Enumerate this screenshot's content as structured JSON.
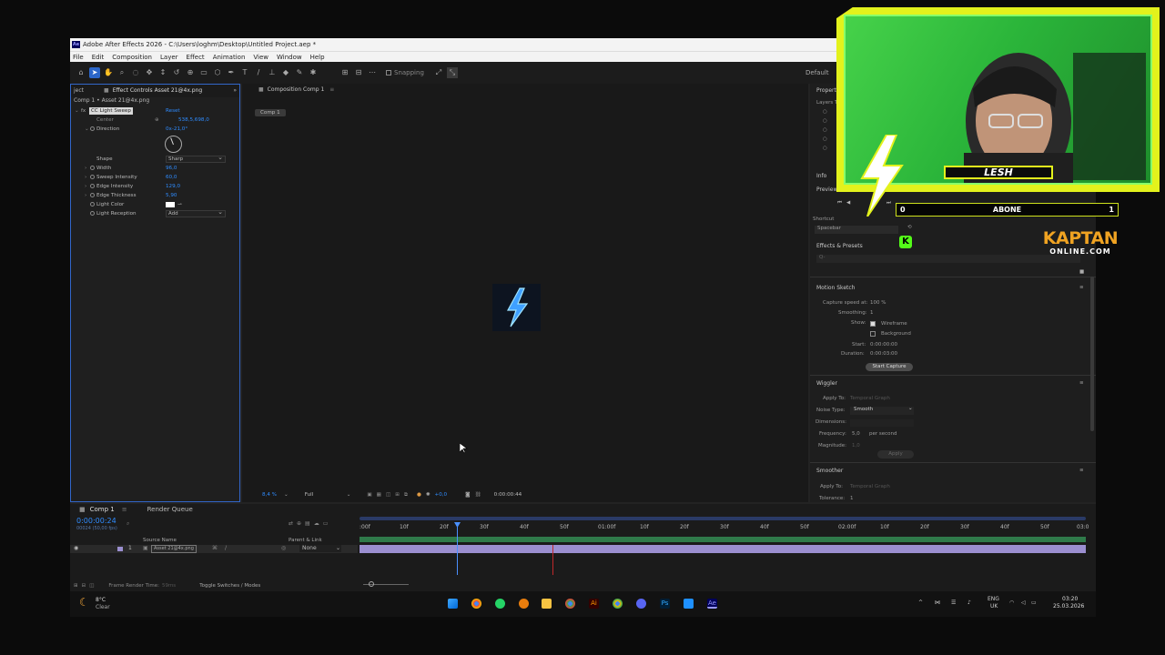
{
  "window": {
    "title": "Adobe After Effects 2026 - C:\\Users\\loghm\\Desktop\\Untitled Project.aep *",
    "app_icon": "Ae"
  },
  "menu": [
    "File",
    "Edit",
    "Composition",
    "Layer",
    "Effect",
    "Animation",
    "View",
    "Window",
    "Help"
  ],
  "toolbar": {
    "snapping": "Snapping",
    "workspace": "Default"
  },
  "effect_controls": {
    "tab_project": "ject",
    "tab_label": "Effect Controls Asset 21@4x.png",
    "layer_path": "Comp 1 • Asset 21@4x.png",
    "effect_name": "CC Light Sweep",
    "reset": "Reset",
    "props": [
      {
        "label": "Center",
        "value": "538,5,698,0"
      },
      {
        "label": "Direction",
        "value": "0x-21,0°"
      },
      {
        "label": "Shape",
        "value": "Sharp"
      },
      {
        "label": "Width",
        "value": "96,0"
      },
      {
        "label": "Sweep Intensity",
        "value": "60,0"
      },
      {
        "label": "Edge Intensity",
        "value": "129,0"
      },
      {
        "label": "Edge Thickness",
        "value": "5,90"
      },
      {
        "label": "Light Color",
        "value": ""
      },
      {
        "label": "Light Reception",
        "value": "Add"
      }
    ]
  },
  "composition": {
    "tab_label": "Composition Comp 1",
    "chip": "Comp 1",
    "zoom": "8,4 %",
    "resolution": "Full",
    "exposure": "+0,0",
    "timecode": "0:00:00:44"
  },
  "right_panel": {
    "properties": "Properties",
    "layers_to": "Layers To",
    "info": "Info",
    "preview": "Preview",
    "shortcut": "Shortcut",
    "shortcut_value": "Spacebar",
    "effects_presets": "Effects & Presets",
    "search_placeholder": "Q-",
    "motion_sketch": {
      "title": "Motion Sketch",
      "capture_speed_label": "Capture speed at:",
      "capture_speed_value": "100 %",
      "smoothing_label": "Smoothing:",
      "smoothing_value": "1",
      "show_label": "Show:",
      "wireframe": "Wireframe",
      "background": "Background",
      "start_label": "Start:",
      "start_value": "0:00:00:00",
      "duration_label": "Duration:",
      "duration_value": "0:00:03:00",
      "button": "Start Capture"
    },
    "wiggler": {
      "title": "Wiggler",
      "apply_to_label": "Apply To:",
      "apply_to_value": "Temporal Graph",
      "noise_type_label": "Noise Type:",
      "noise_type_value": "Smooth",
      "dimensions_label": "Dimensions:",
      "frequency_label": "Frequency:",
      "frequency_value": "5,0",
      "frequency_unit": "per second",
      "magnitude_label": "Magnitude:",
      "magnitude_value": "1,0",
      "apply": "Apply"
    },
    "smoother": {
      "title": "Smoother",
      "apply_to_label": "Apply To:",
      "apply_to_value": "Temporal Graph",
      "tolerance_label": "Tolerance:",
      "tolerance_value": "1"
    }
  },
  "timeline": {
    "tab_comp": "Comp 1",
    "tab_render": "Render Queue",
    "timecode": "0:00:00:24",
    "fps": "00024 (50,00 fps)",
    "col_source": "Source Name",
    "col_parent": "Parent & Link",
    "layer_number": "1",
    "layer_name": "Asset 21@4x.png",
    "parent_value": "None",
    "ruler": [
      ":00f",
      "10f",
      "20f",
      "30f",
      "40f",
      "50f",
      "01:00f",
      "10f",
      "20f",
      "30f",
      "40f",
      "50f",
      "02:00f",
      "10f",
      "20f",
      "30f",
      "40f",
      "50f",
      "03:0"
    ],
    "frame_render": "Frame Render Time:",
    "frame_render_value": "59ms",
    "toggle": "Toggle Switches / Modes"
  },
  "taskbar": {
    "weather_temp": "8°C",
    "weather_desc": "Clear",
    "lang1": "ENG",
    "lang2": "UK",
    "time": "03:20",
    "date": "25.03.2026"
  },
  "overlay": {
    "name": "LESH",
    "sub_left": "0",
    "sub_label": "ABONE",
    "sub_right": "1",
    "brand_line1": "KAPTAN",
    "brand_line2": "ONLINE.COM"
  }
}
